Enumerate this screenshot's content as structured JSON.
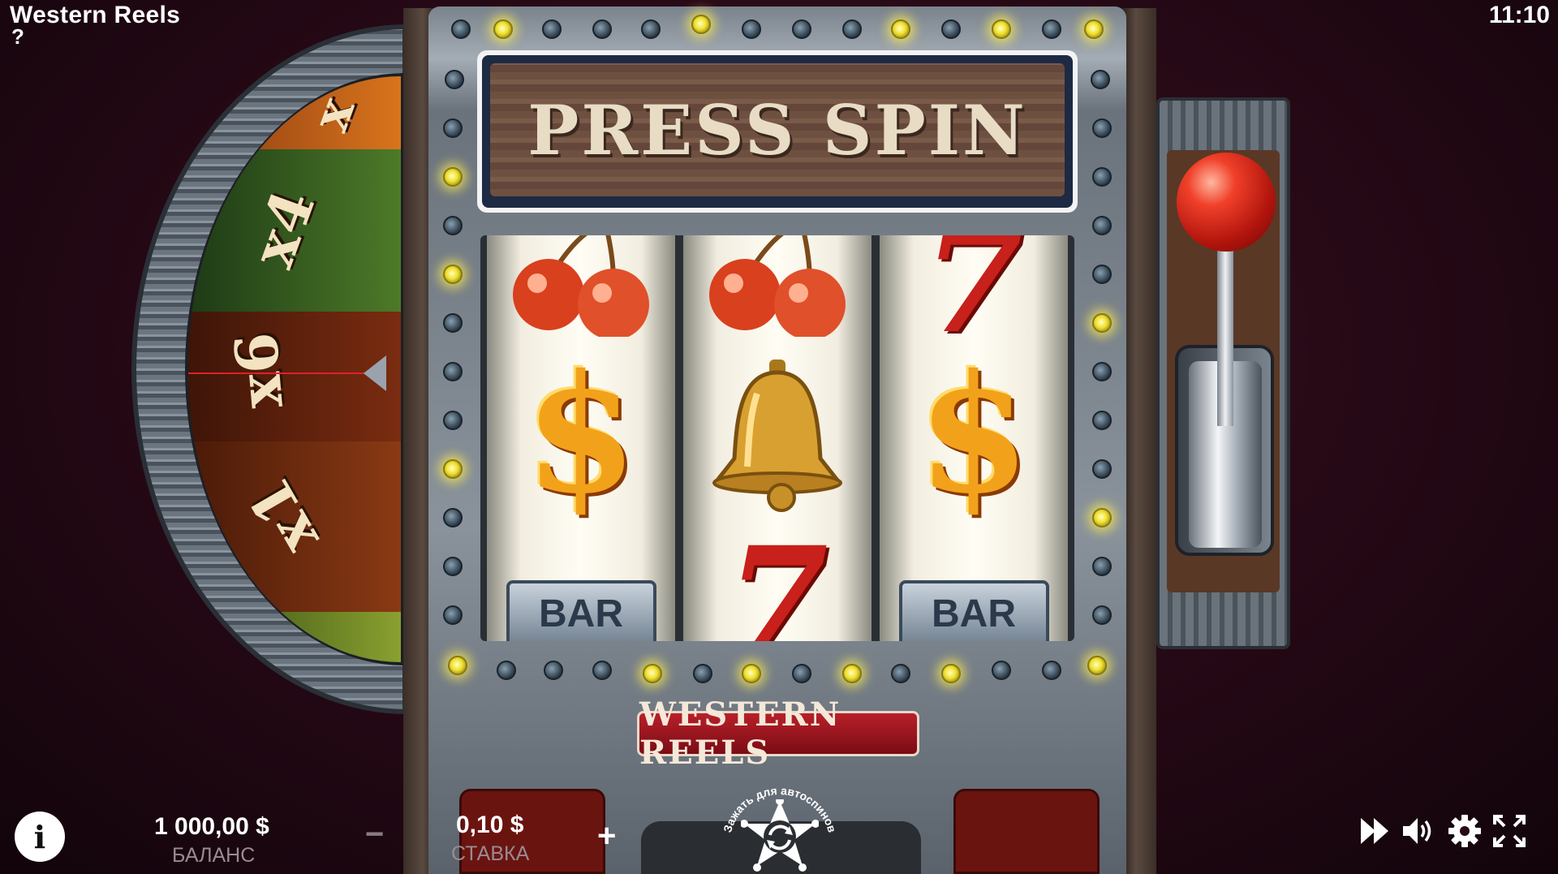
{
  "header": {
    "title": "Western Reels",
    "help": "?",
    "clock": "11:10"
  },
  "wheel": {
    "multipliers": [
      "x",
      "x4",
      "x6",
      "x1"
    ]
  },
  "sign": {
    "text": "PRESS SPIN"
  },
  "reels": [
    {
      "top": "cherries",
      "middle": "$",
      "bottom": "BAR"
    },
    {
      "top": "cherries",
      "middle": "bell",
      "bottom": "7"
    },
    {
      "top": "7",
      "middle": "$",
      "bottom": "BAR"
    }
  ],
  "brand": {
    "text": "WESTERN REELS"
  },
  "bottom_bar": {
    "info_label": "i",
    "balance_value": "1 000,00 $",
    "balance_label": "БАЛАНС",
    "bet_minus": "−",
    "bet_value": "0,10 $",
    "bet_label": "СТАВКА",
    "bet_plus": "+",
    "spin_hint": "Зажать для автоспинов"
  },
  "icons": [
    "info-icon",
    "spin-icon",
    "fast-forward-icon",
    "sound-icon",
    "settings-icon",
    "fullscreen-icon"
  ],
  "colors": {
    "background": "#2a0a18",
    "bulb_lit": "#f0e030",
    "brand_plate": "#b8202a",
    "lever_knob": "#f0402a"
  }
}
